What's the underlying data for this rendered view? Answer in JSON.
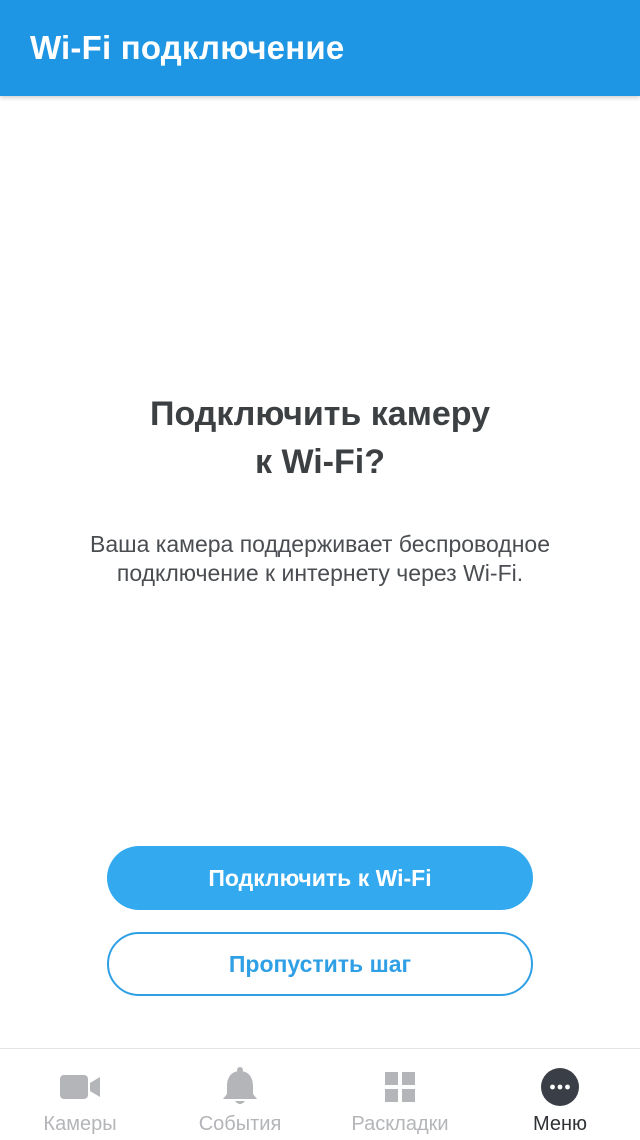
{
  "header": {
    "title": "Wi-Fi подключение"
  },
  "main": {
    "heading_line1": "Подключить камеру",
    "heading_line2": "к Wi-Fi?",
    "description_line1": "Ваша камера поддерживает беспроводное",
    "description_line2": "подключение к интернету через Wi-Fi."
  },
  "actions": {
    "primary_label": "Подключить к Wi-Fi",
    "secondary_label": "Пропустить шаг"
  },
  "bottom_nav": {
    "items": [
      {
        "label": "Камеры",
        "icon": "camera-icon",
        "active": false
      },
      {
        "label": "События",
        "icon": "bell-icon",
        "active": false
      },
      {
        "label": "Раскладки",
        "icon": "grid-icon",
        "active": false
      },
      {
        "label": "Меню",
        "icon": "more-icon",
        "active": true
      }
    ]
  },
  "colors": {
    "app_bar": "#1f96e3",
    "primary_button": "#33a9ef",
    "accent": "#2f9fe6",
    "inactive_nav": "#b3b5b8",
    "active_nav": "#2f3236"
  }
}
